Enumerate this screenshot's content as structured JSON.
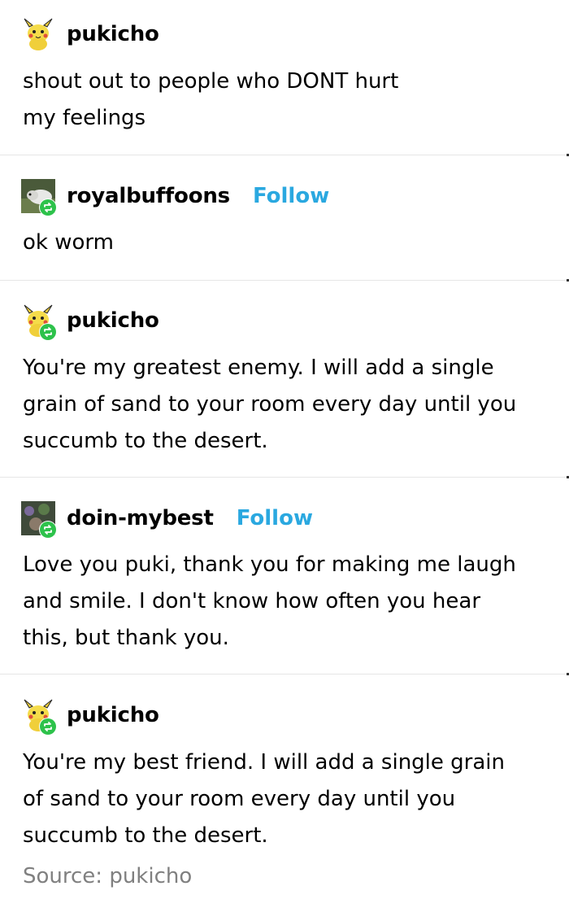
{
  "posts": [
    {
      "username": "pukicho",
      "text": "shout out to people who DONT hurt\nmy feelings"
    },
    {
      "username": "royalbuffoons",
      "follow": "Follow",
      "text": "ok worm"
    },
    {
      "username": "pukicho",
      "text": "You're my greatest enemy. I will add a single\ngrain of sand to your room every day until you\nsuccumb to the desert."
    },
    {
      "username": "doin-mybest",
      "follow": "Follow",
      "text": "Love you puki, thank you for making me laugh\nand smile. I don't know how often you hear\nthis, but thank you."
    },
    {
      "username": "pukicho",
      "text": "You're my best friend. I will add a single grain\nof sand to your room every day until you\nsuccumb to the desert."
    }
  ],
  "source": "Source: pukicho",
  "colors": {
    "follow": "#2aa8e0",
    "reblog_badge": "#2dc24b",
    "divider": "#e6e6e6",
    "source": "#808080"
  },
  "icons": {
    "avatar_pukicho": "pikachu-plush-icon",
    "reblog": "reblog-icon"
  }
}
